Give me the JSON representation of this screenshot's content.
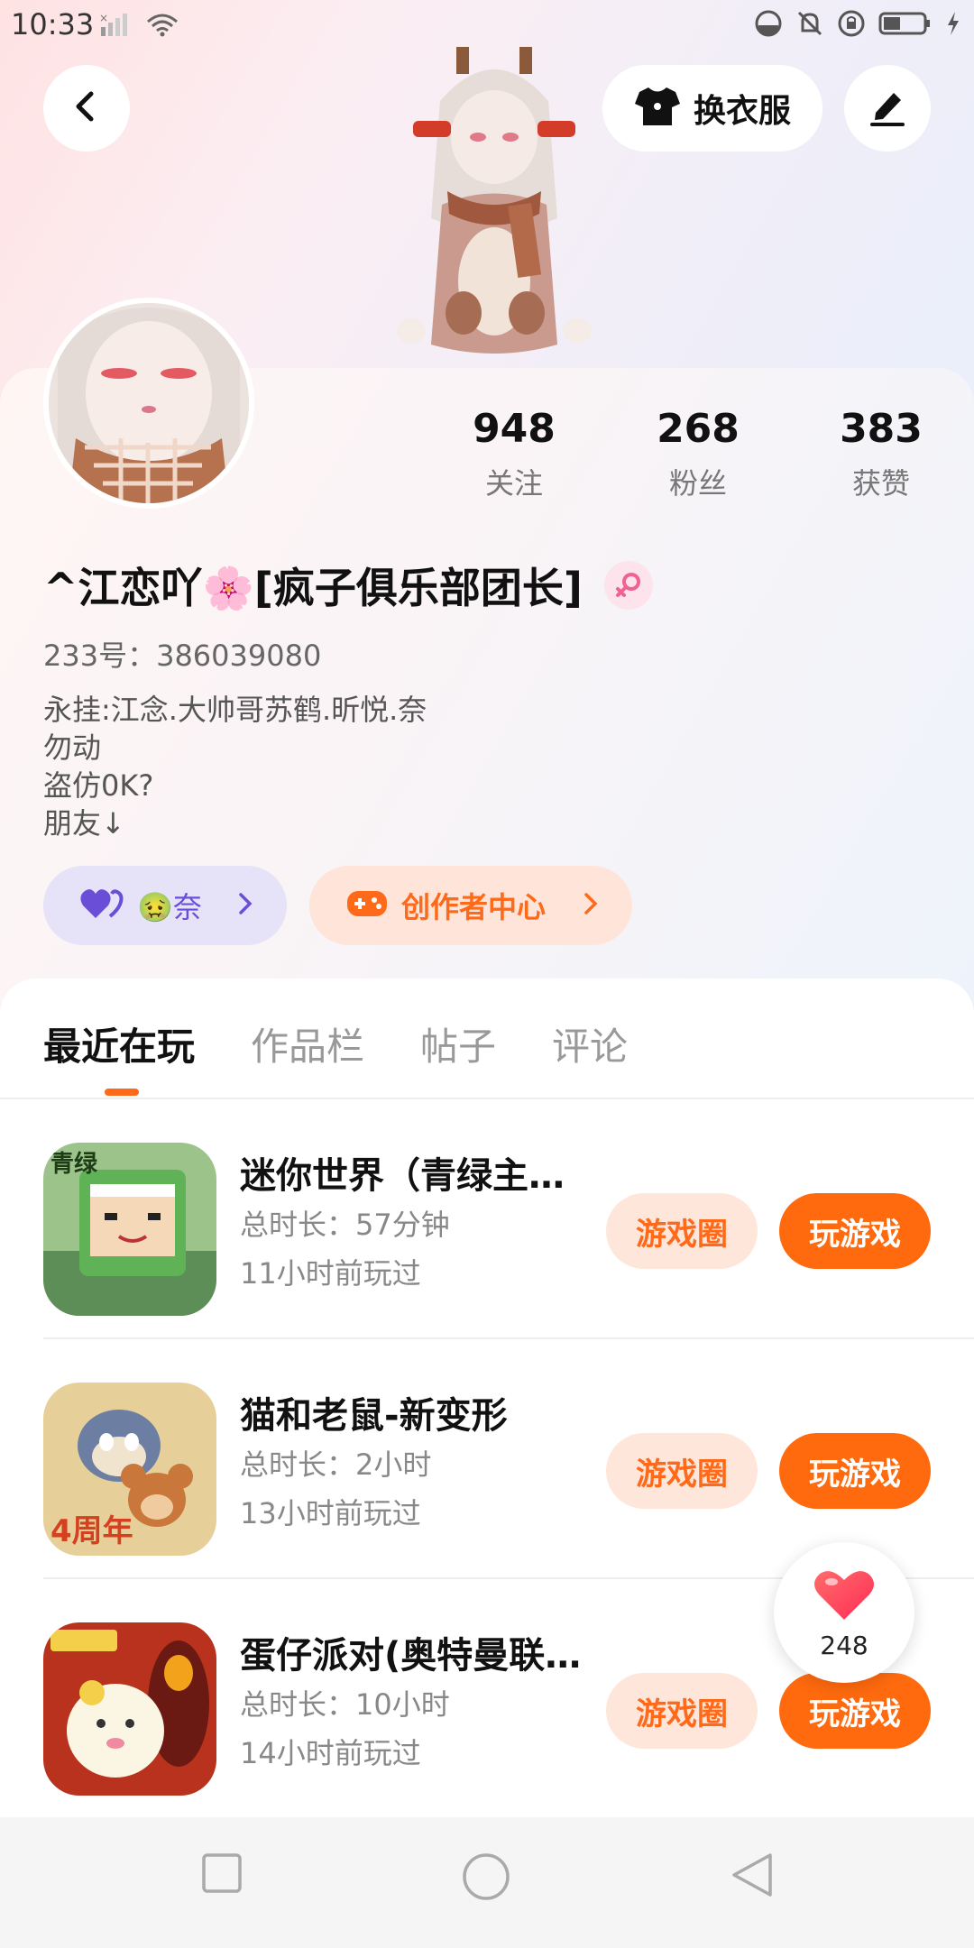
{
  "status_bar": {
    "time": "10:33",
    "icons": [
      "sim-no-signal-icon",
      "wifi-icon",
      "data-saver-icon",
      "mute-icon",
      "rotation-lock-icon",
      "battery-icon",
      "charging-icon"
    ]
  },
  "header": {
    "dress_up_label": "换衣服"
  },
  "profile": {
    "nickname": "^江恋吖🌸[疯子俱乐部团长]",
    "id_label": "233号：386039080",
    "bio_lines": [
      "永挂:江念.大帅哥苏鹤.昕悦.奈",
      "勿动",
      "盗仿0K?",
      "朋友↓"
    ],
    "stats": [
      {
        "value": "948",
        "label": "关注"
      },
      {
        "value": "268",
        "label": "粉丝"
      },
      {
        "value": "383",
        "label": "获赞"
      }
    ],
    "friend_pill_label": "🤢奈",
    "creator_pill_label": "创作者中心"
  },
  "tabs": [
    "最近在玩",
    "作品栏",
    "帖子",
    "评论"
  ],
  "games": [
    {
      "title": "迷你世界（青绿主…",
      "duration": "总时长：57分钟",
      "last_played": "11小时前玩过",
      "circle_label": "游戏圈",
      "play_label": "玩游戏"
    },
    {
      "title": "猫和老鼠-新变形",
      "duration": "总时长：2小时",
      "last_played": "13小时前玩过",
      "circle_label": "游戏圈",
      "play_label": "玩游戏"
    },
    {
      "title": "蛋仔派对(奥特曼联…",
      "duration": "总时长：10小时",
      "last_played": "14小时前玩过",
      "circle_label": "游戏圈",
      "play_label": "玩游戏"
    }
  ],
  "like_float": {
    "count": "248"
  },
  "colors": {
    "accent": "#ff6a0e",
    "accent_light": "#ffe6da",
    "friend_purple": "#6a4ed8"
  }
}
